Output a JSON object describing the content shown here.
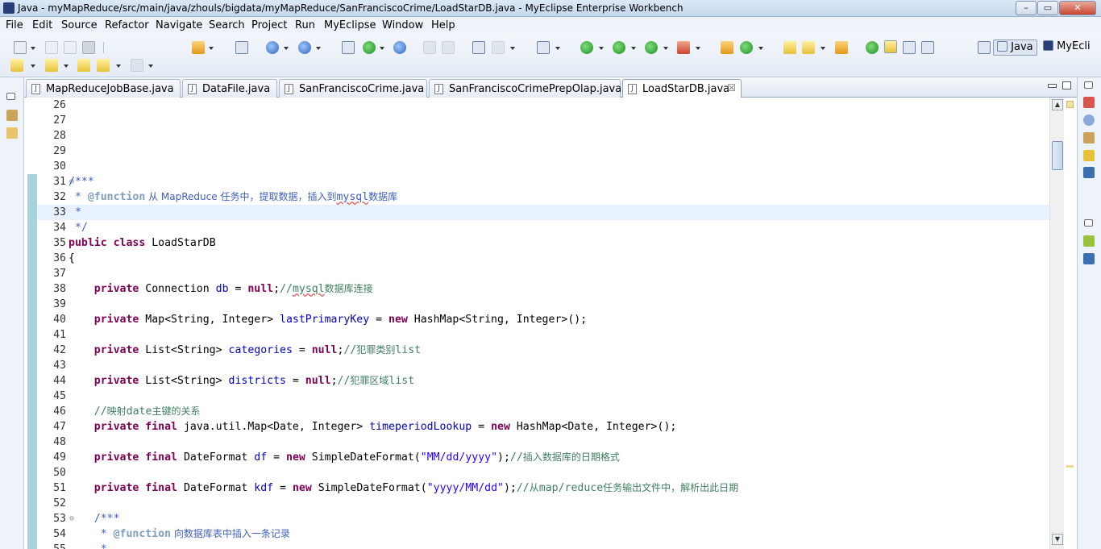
{
  "window": {
    "title": "Java - myMapReduce/src/main/java/zhouls/bigdata/myMapReduce/SanFranciscoCrime/LoadStarDB.java - MyEclipse Enterprise Workbench",
    "minimize_glyph": "–",
    "maximize_glyph": "▭",
    "close_glyph": "✕"
  },
  "menu": [
    "File",
    "Edit",
    "Source",
    "Refactor",
    "Navigate",
    "Search",
    "Project",
    "Run",
    "MyEclipse",
    "Window",
    "Help"
  ],
  "perspectives": {
    "active": "Java",
    "other": "MyEcli"
  },
  "tabs": [
    {
      "label": "MapReduceJobBase.java",
      "active": false
    },
    {
      "label": "DataFile.java",
      "active": false
    },
    {
      "label": "SanFranciscoCrime.java",
      "active": false
    },
    {
      "label": "SanFranciscoCrimePrepOlap.java",
      "active": false
    },
    {
      "label": "LoadStarDB.java",
      "active": true
    }
  ],
  "tab_close_glyph": "☒",
  "file_icon_glyph": "J",
  "fold_glyph": "⊖",
  "code": {
    "lines": [
      {
        "n": "26",
        "fold": false,
        "hl": false,
        "tokens": []
      },
      {
        "n": "27",
        "fold": false,
        "hl": false,
        "tokens": []
      },
      {
        "n": "28",
        "fold": false,
        "hl": false,
        "tokens": []
      },
      {
        "n": "29",
        "fold": false,
        "hl": false,
        "tokens": []
      },
      {
        "n": "30",
        "fold": false,
        "hl": false,
        "tokens": []
      },
      {
        "n": "31",
        "fold": true,
        "hl": false,
        "tokens": [
          {
            "t": "/***",
            "c": "jd"
          }
        ]
      },
      {
        "n": "32",
        "fold": false,
        "hl": false,
        "tokens": [
          {
            "t": " * ",
            "c": "jd"
          },
          {
            "t": "@function",
            "c": "jdt"
          },
          {
            "t": " 从 MapReduce 任务中，提取数据，插入到",
            "c": "jd cjk"
          },
          {
            "t": "mysql",
            "c": "jd spell"
          },
          {
            "t": "数据库",
            "c": "jd cjk"
          }
        ]
      },
      {
        "n": "33",
        "fold": false,
        "hl": true,
        "tokens": [
          {
            "t": " *",
            "c": "jd"
          }
        ]
      },
      {
        "n": "34",
        "fold": false,
        "hl": false,
        "tokens": [
          {
            "t": " */",
            "c": "jd"
          }
        ]
      },
      {
        "n": "35",
        "fold": false,
        "hl": false,
        "tokens": [
          {
            "t": "public",
            "c": "kw"
          },
          {
            "t": " ",
            "c": ""
          },
          {
            "t": "class",
            "c": "kw"
          },
          {
            "t": " LoadStarDB",
            "c": ""
          }
        ]
      },
      {
        "n": "36",
        "fold": false,
        "hl": false,
        "tokens": [
          {
            "t": "{",
            "c": ""
          }
        ]
      },
      {
        "n": "37",
        "fold": false,
        "hl": false,
        "tokens": []
      },
      {
        "n": "38",
        "fold": false,
        "hl": false,
        "tokens": [
          {
            "t": "    ",
            "c": ""
          },
          {
            "t": "private",
            "c": "kw"
          },
          {
            "t": " Connection ",
            "c": ""
          },
          {
            "t": "db",
            "c": "fld"
          },
          {
            "t": " = ",
            "c": ""
          },
          {
            "t": "null",
            "c": "kw"
          },
          {
            "t": ";",
            "c": ""
          },
          {
            "t": "//",
            "c": "cm"
          },
          {
            "t": "mysql",
            "c": "cm spell"
          },
          {
            "t": "数据库连接",
            "c": "cm cjk"
          }
        ]
      },
      {
        "n": "39",
        "fold": false,
        "hl": false,
        "tokens": []
      },
      {
        "n": "40",
        "fold": false,
        "hl": false,
        "tokens": [
          {
            "t": "    ",
            "c": ""
          },
          {
            "t": "private",
            "c": "kw"
          },
          {
            "t": " Map<String, Integer> ",
            "c": ""
          },
          {
            "t": "lastPrimaryKey",
            "c": "fld"
          },
          {
            "t": " = ",
            "c": ""
          },
          {
            "t": "new",
            "c": "kw"
          },
          {
            "t": " HashMap<String, Integer>();",
            "c": ""
          }
        ]
      },
      {
        "n": "41",
        "fold": false,
        "hl": false,
        "tokens": []
      },
      {
        "n": "42",
        "fold": false,
        "hl": false,
        "tokens": [
          {
            "t": "    ",
            "c": ""
          },
          {
            "t": "private",
            "c": "kw"
          },
          {
            "t": " List<String> ",
            "c": ""
          },
          {
            "t": "categories",
            "c": "fld"
          },
          {
            "t": " = ",
            "c": ""
          },
          {
            "t": "null",
            "c": "kw"
          },
          {
            "t": ";",
            "c": ""
          },
          {
            "t": "//",
            "c": "cm"
          },
          {
            "t": "犯罪类别",
            "c": "cm cjk"
          },
          {
            "t": "list",
            "c": "cm"
          }
        ]
      },
      {
        "n": "43",
        "fold": false,
        "hl": false,
        "tokens": []
      },
      {
        "n": "44",
        "fold": false,
        "hl": false,
        "tokens": [
          {
            "t": "    ",
            "c": ""
          },
          {
            "t": "private",
            "c": "kw"
          },
          {
            "t": " List<String> ",
            "c": ""
          },
          {
            "t": "districts",
            "c": "fld"
          },
          {
            "t": " = ",
            "c": ""
          },
          {
            "t": "null",
            "c": "kw"
          },
          {
            "t": ";",
            "c": ""
          },
          {
            "t": "//",
            "c": "cm"
          },
          {
            "t": "犯罪区域",
            "c": "cm cjk"
          },
          {
            "t": "list",
            "c": "cm"
          }
        ]
      },
      {
        "n": "45",
        "fold": false,
        "hl": false,
        "tokens": []
      },
      {
        "n": "46",
        "fold": false,
        "hl": false,
        "tokens": [
          {
            "t": "    ",
            "c": ""
          },
          {
            "t": "//",
            "c": "cm"
          },
          {
            "t": "映射",
            "c": "cm cjk"
          },
          {
            "t": "date",
            "c": "cm"
          },
          {
            "t": "主键的关系",
            "c": "cm cjk"
          }
        ]
      },
      {
        "n": "47",
        "fold": false,
        "hl": false,
        "tokens": [
          {
            "t": "    ",
            "c": ""
          },
          {
            "t": "private",
            "c": "kw"
          },
          {
            "t": " ",
            "c": ""
          },
          {
            "t": "final",
            "c": "kw"
          },
          {
            "t": " java.util.Map<Date, Integer> ",
            "c": ""
          },
          {
            "t": "timeperiodLookup",
            "c": "fld"
          },
          {
            "t": " = ",
            "c": ""
          },
          {
            "t": "new",
            "c": "kw"
          },
          {
            "t": " HashMap<Date, Integer>();",
            "c": ""
          }
        ]
      },
      {
        "n": "48",
        "fold": false,
        "hl": false,
        "tokens": []
      },
      {
        "n": "49",
        "fold": false,
        "hl": false,
        "tokens": [
          {
            "t": "    ",
            "c": ""
          },
          {
            "t": "private",
            "c": "kw"
          },
          {
            "t": " ",
            "c": ""
          },
          {
            "t": "final",
            "c": "kw"
          },
          {
            "t": " DateFormat ",
            "c": ""
          },
          {
            "t": "df",
            "c": "fld"
          },
          {
            "t": " = ",
            "c": ""
          },
          {
            "t": "new",
            "c": "kw"
          },
          {
            "t": " SimpleDateFormat(",
            "c": ""
          },
          {
            "t": "\"MM/dd/yyyy\"",
            "c": "str"
          },
          {
            "t": ");",
            "c": ""
          },
          {
            "t": "//",
            "c": "cm"
          },
          {
            "t": "插入数据库的日期格式",
            "c": "cm cjk"
          }
        ]
      },
      {
        "n": "50",
        "fold": false,
        "hl": false,
        "tokens": []
      },
      {
        "n": "51",
        "fold": false,
        "hl": false,
        "tokens": [
          {
            "t": "    ",
            "c": ""
          },
          {
            "t": "private",
            "c": "kw"
          },
          {
            "t": " ",
            "c": ""
          },
          {
            "t": "final",
            "c": "kw"
          },
          {
            "t": " DateFormat ",
            "c": ""
          },
          {
            "t": "kdf",
            "c": "fld"
          },
          {
            "t": " = ",
            "c": ""
          },
          {
            "t": "new",
            "c": "kw"
          },
          {
            "t": " SimpleDateFormat(",
            "c": ""
          },
          {
            "t": "\"yyyy/MM/dd\"",
            "c": "str"
          },
          {
            "t": ");",
            "c": ""
          },
          {
            "t": "//",
            "c": "cm"
          },
          {
            "t": "从",
            "c": "cm cjk"
          },
          {
            "t": "map/reduce",
            "c": "cm"
          },
          {
            "t": "任务输出文件中，解析出此日期",
            "c": "cm cjk"
          }
        ]
      },
      {
        "n": "52",
        "fold": false,
        "hl": false,
        "tokens": []
      },
      {
        "n": "53",
        "fold": true,
        "hl": false,
        "tokens": [
          {
            "t": "    ",
            "c": ""
          },
          {
            "t": "/***",
            "c": "jd"
          }
        ]
      },
      {
        "n": "54",
        "fold": false,
        "hl": false,
        "tokens": [
          {
            "t": "     * ",
            "c": "jd"
          },
          {
            "t": "@function",
            "c": "jdt"
          },
          {
            "t": " 向数据库表中插入一条记录",
            "c": "jd cjk"
          }
        ]
      },
      {
        "n": "55",
        "fold": false,
        "hl": false,
        "tokens": [
          {
            "t": "     * ",
            "c": "jd"
          }
        ]
      }
    ]
  }
}
